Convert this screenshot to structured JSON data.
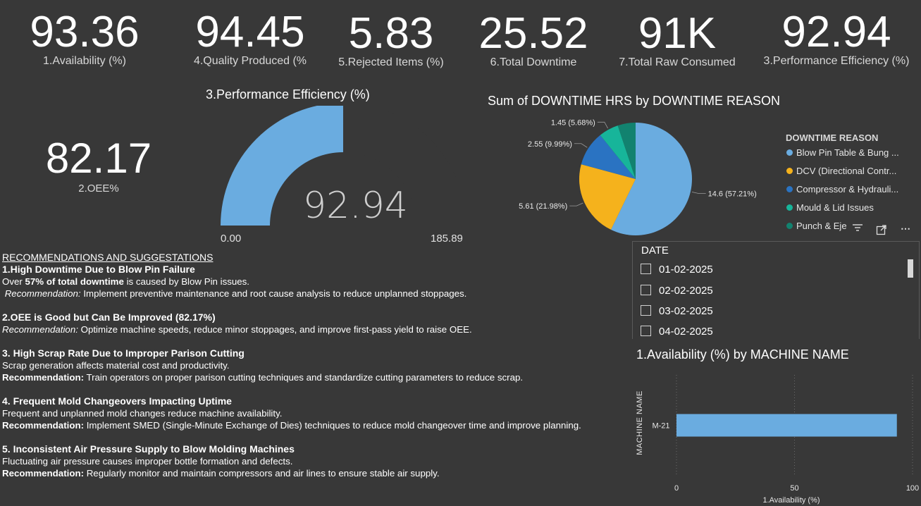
{
  "kpis": [
    {
      "value": "93.36",
      "label": "1.Availability (%)"
    },
    {
      "value": "94.45",
      "label": "4.Quality Produced (%"
    },
    {
      "value": "5.83",
      "label": "5.Rejected Items (%)"
    },
    {
      "value": "25.52",
      "label": "6.Total Downtime"
    },
    {
      "value": "91K",
      "label": "7.Total Raw Consumed"
    },
    {
      "value": "92.94",
      "label": "3.Performance Efficiency (%)"
    }
  ],
  "oee": {
    "value": "82.17",
    "label": "2.OEE%"
  },
  "gauge": {
    "title": "3.Performance Efficiency (%)",
    "value": 92.94,
    "value_text": "92.94",
    "min_text": "0.00",
    "max_text": "185.89",
    "min": 0,
    "max": 185.89,
    "color": "#6aace0",
    "track_color": "#383838"
  },
  "pie": {
    "title": "Sum of DOWNTIME HRS by DOWNTIME REASON",
    "legend_title": "DOWNTIME REASON",
    "legend": [
      {
        "label": "Blow Pin Table & Bung ...",
        "color": "#6aace0"
      },
      {
        "label": "DCV (Directional Contr...",
        "color": "#f5b21c"
      },
      {
        "label": "Compressor & Hydrauli...",
        "color": "#2a73c2"
      },
      {
        "label": "Mould & Lid Issues",
        "color": "#17b59a"
      },
      {
        "label": "Punch & Eje",
        "color": "#12826f"
      }
    ]
  },
  "chart_data": [
    {
      "type": "pie",
      "title": "Sum of DOWNTIME HRS by DOWNTIME REASON",
      "legend_title": "DOWNTIME REASON",
      "labels": [
        "Blow Pin Table & Bung ...",
        "DCV (Directional Contr...",
        "Compressor & Hydrauli...",
        "Mould & Lid Issues",
        "Punch & Eje"
      ],
      "values": [
        14.6,
        5.61,
        2.55,
        1.45,
        1.31
      ],
      "data_labels": [
        "14.6 (57.21%)",
        "5.61 (21.98%)",
        "2.55 (9.99%)",
        "1.45 (5.68%)",
        ""
      ],
      "colors": [
        "#6aace0",
        "#f5b21c",
        "#2a73c2",
        "#17b59a",
        "#12826f"
      ],
      "legend_position": "right"
    },
    {
      "type": "bar",
      "orientation": "horizontal",
      "title": "1.Availability (%) by MACHINE NAME",
      "categories": [
        "M-21"
      ],
      "values": [
        93.36
      ],
      "xlabel": "1.Availability (%)",
      "ylabel": "MACHINE NAME",
      "xlim": [
        0,
        100
      ],
      "xticks": [
        "0",
        "50",
        "100"
      ],
      "color": "#6aace0"
    }
  ],
  "slicer": {
    "title": "DATE",
    "items": [
      "01-02-2025",
      "02-02-2025",
      "03-02-2025",
      "04-02-2025"
    ]
  },
  "recommendations": {
    "heading": "RECOMMENDATIONS AND SUGGESTATIONS",
    "r1_title": "1.High Downtime Due to Blow Pin Failure",
    "r1_a": "Over ",
    "r1_b": "57% of total downtime",
    "r1_c": " is caused by Blow Pin issues.",
    "r1_rec_label": "Recommendation:",
    "r1_rec": " Implement preventive maintenance and root cause analysis to reduce unplanned stoppages.",
    "r2_title": "2.OEE is Good but Can Be Improved (82.17%)",
    "r2_rec_label": "Recommendation:",
    "r2_rec": " Optimize machine speeds, reduce minor stoppages, and improve first-pass yield to raise OEE.",
    "r3_title": "3. High Scrap Rate Due to Improper Parison Cutting",
    "r3_a": "Scrap generation affects material cost and productivity.",
    "r3_rec_label": "Recommendation:",
    "r3_rec": " Train operators on proper parison cutting techniques and standardize cutting parameters to reduce scrap.",
    "r4_title": "4. Frequent Mold Changeovers Impacting Uptime",
    "r4_a": "Frequent and unplanned mold changes reduce machine availability.",
    "r4_rec_label": "Recommendation:",
    "r4_rec": " Implement SMED (Single-Minute Exchange of Dies) techniques to reduce mold changeover time and improve planning.",
    "r5_title": "5. Inconsistent Air Pressure Supply to Blow Molding Machines",
    "r5_a": "Fluctuating air pressure causes improper bottle formation and defects.",
    "r5_rec_label": "Recommendation:",
    "r5_rec": " Regularly monitor and maintain compressors and air lines to ensure stable air supply."
  },
  "icons": [
    "filter-icon",
    "focus-mode-icon",
    "more-options-icon"
  ]
}
